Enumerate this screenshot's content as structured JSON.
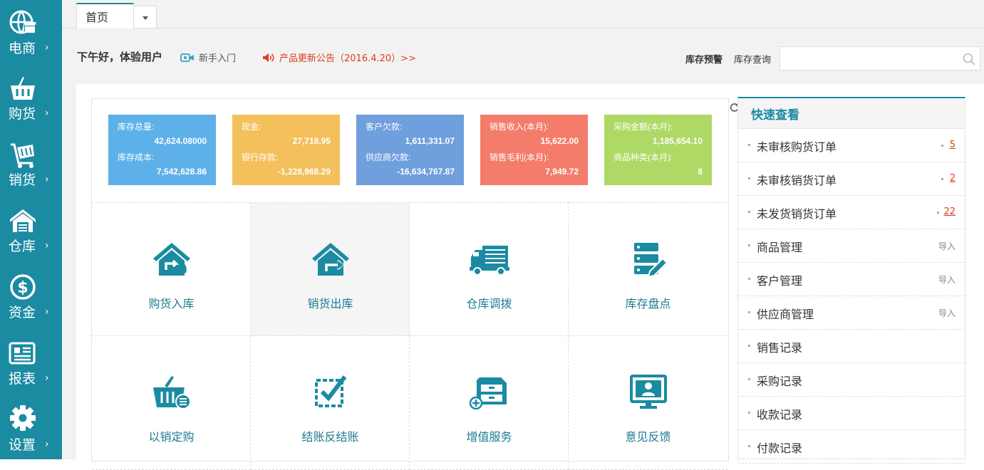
{
  "sidebar": {
    "items": [
      {
        "label": "电商",
        "icon": "globe-shop-icon"
      },
      {
        "label": "购货",
        "icon": "basket-icon"
      },
      {
        "label": "销货",
        "icon": "cart-icon"
      },
      {
        "label": "仓库",
        "icon": "warehouse-icon"
      },
      {
        "label": "资金",
        "icon": "dollar-icon"
      },
      {
        "label": "报表",
        "icon": "report-icon"
      },
      {
        "label": "设置",
        "icon": "gear-icon"
      }
    ],
    "arrow": "›"
  },
  "tabs": {
    "home": "首页"
  },
  "header": {
    "greeting": "下午好，体验用户",
    "guide": "新手入门",
    "notice": "产品更新公告（2016.4.20）>>",
    "stock_alert": "库存预警",
    "stock_query": "库存查询",
    "search_placeholder": ""
  },
  "stats": [
    {
      "color": "#5db1e8",
      "rows": [
        {
          "label": "库存总量:",
          "value": "42,624.08000"
        },
        {
          "label": "库存成本:",
          "value": "7,542,628.86"
        }
      ]
    },
    {
      "color": "#f3c05b",
      "rows": [
        {
          "label": "现金:",
          "value": "27,718.95"
        },
        {
          "label": "银行存款:",
          "value": "-1,228,968.29"
        }
      ]
    },
    {
      "color": "#6f9fdc",
      "rows": [
        {
          "label": "客户欠款:",
          "value": "1,611,331.07"
        },
        {
          "label": "供应商欠款:",
          "value": "-16,634,767.87"
        }
      ]
    },
    {
      "color": "#f47c6b",
      "rows": [
        {
          "label": "销售收入(本月):",
          "value": "15,622.00"
        },
        {
          "label": "销售毛利(本月):",
          "value": "7,949.72"
        }
      ]
    },
    {
      "color": "#aed965",
      "rows": [
        {
          "label": "采购金额(本月):",
          "value": "1,185,654.10"
        },
        {
          "label": "商品种类(本月):",
          "value": "8"
        }
      ]
    }
  ],
  "tiles": [
    {
      "label": "购货入库",
      "icon": "purchase-inbound-icon"
    },
    {
      "label": "销货出库",
      "icon": "sales-outbound-icon"
    },
    {
      "label": "仓库调拨",
      "icon": "truck-icon"
    },
    {
      "label": "库存盘点",
      "icon": "inventory-check-icon"
    },
    {
      "label": "以销定购",
      "icon": "basket-list-icon"
    },
    {
      "label": "结账反结账",
      "icon": "checkbox-icon"
    },
    {
      "label": "增值服务",
      "icon": "cabinet-plus-icon"
    },
    {
      "label": "意见反馈",
      "icon": "monitor-user-icon"
    }
  ],
  "quick": {
    "title": "快速查看",
    "items": [
      {
        "label": "未审核购货订单",
        "count": "5"
      },
      {
        "label": "未审核销货订单",
        "count": "2"
      },
      {
        "label": "未发货销货订单",
        "count": "22"
      },
      {
        "label": "商品管理",
        "action": "导入"
      },
      {
        "label": "客户管理",
        "action": "导入"
      },
      {
        "label": "供应商管理",
        "action": "导入"
      },
      {
        "label": "销售记录"
      },
      {
        "label": "采购记录"
      },
      {
        "label": "收款记录"
      },
      {
        "label": "付款记录"
      }
    ]
  },
  "colors": {
    "brand": "#1b8ba2",
    "alert": "#e03b1e"
  }
}
